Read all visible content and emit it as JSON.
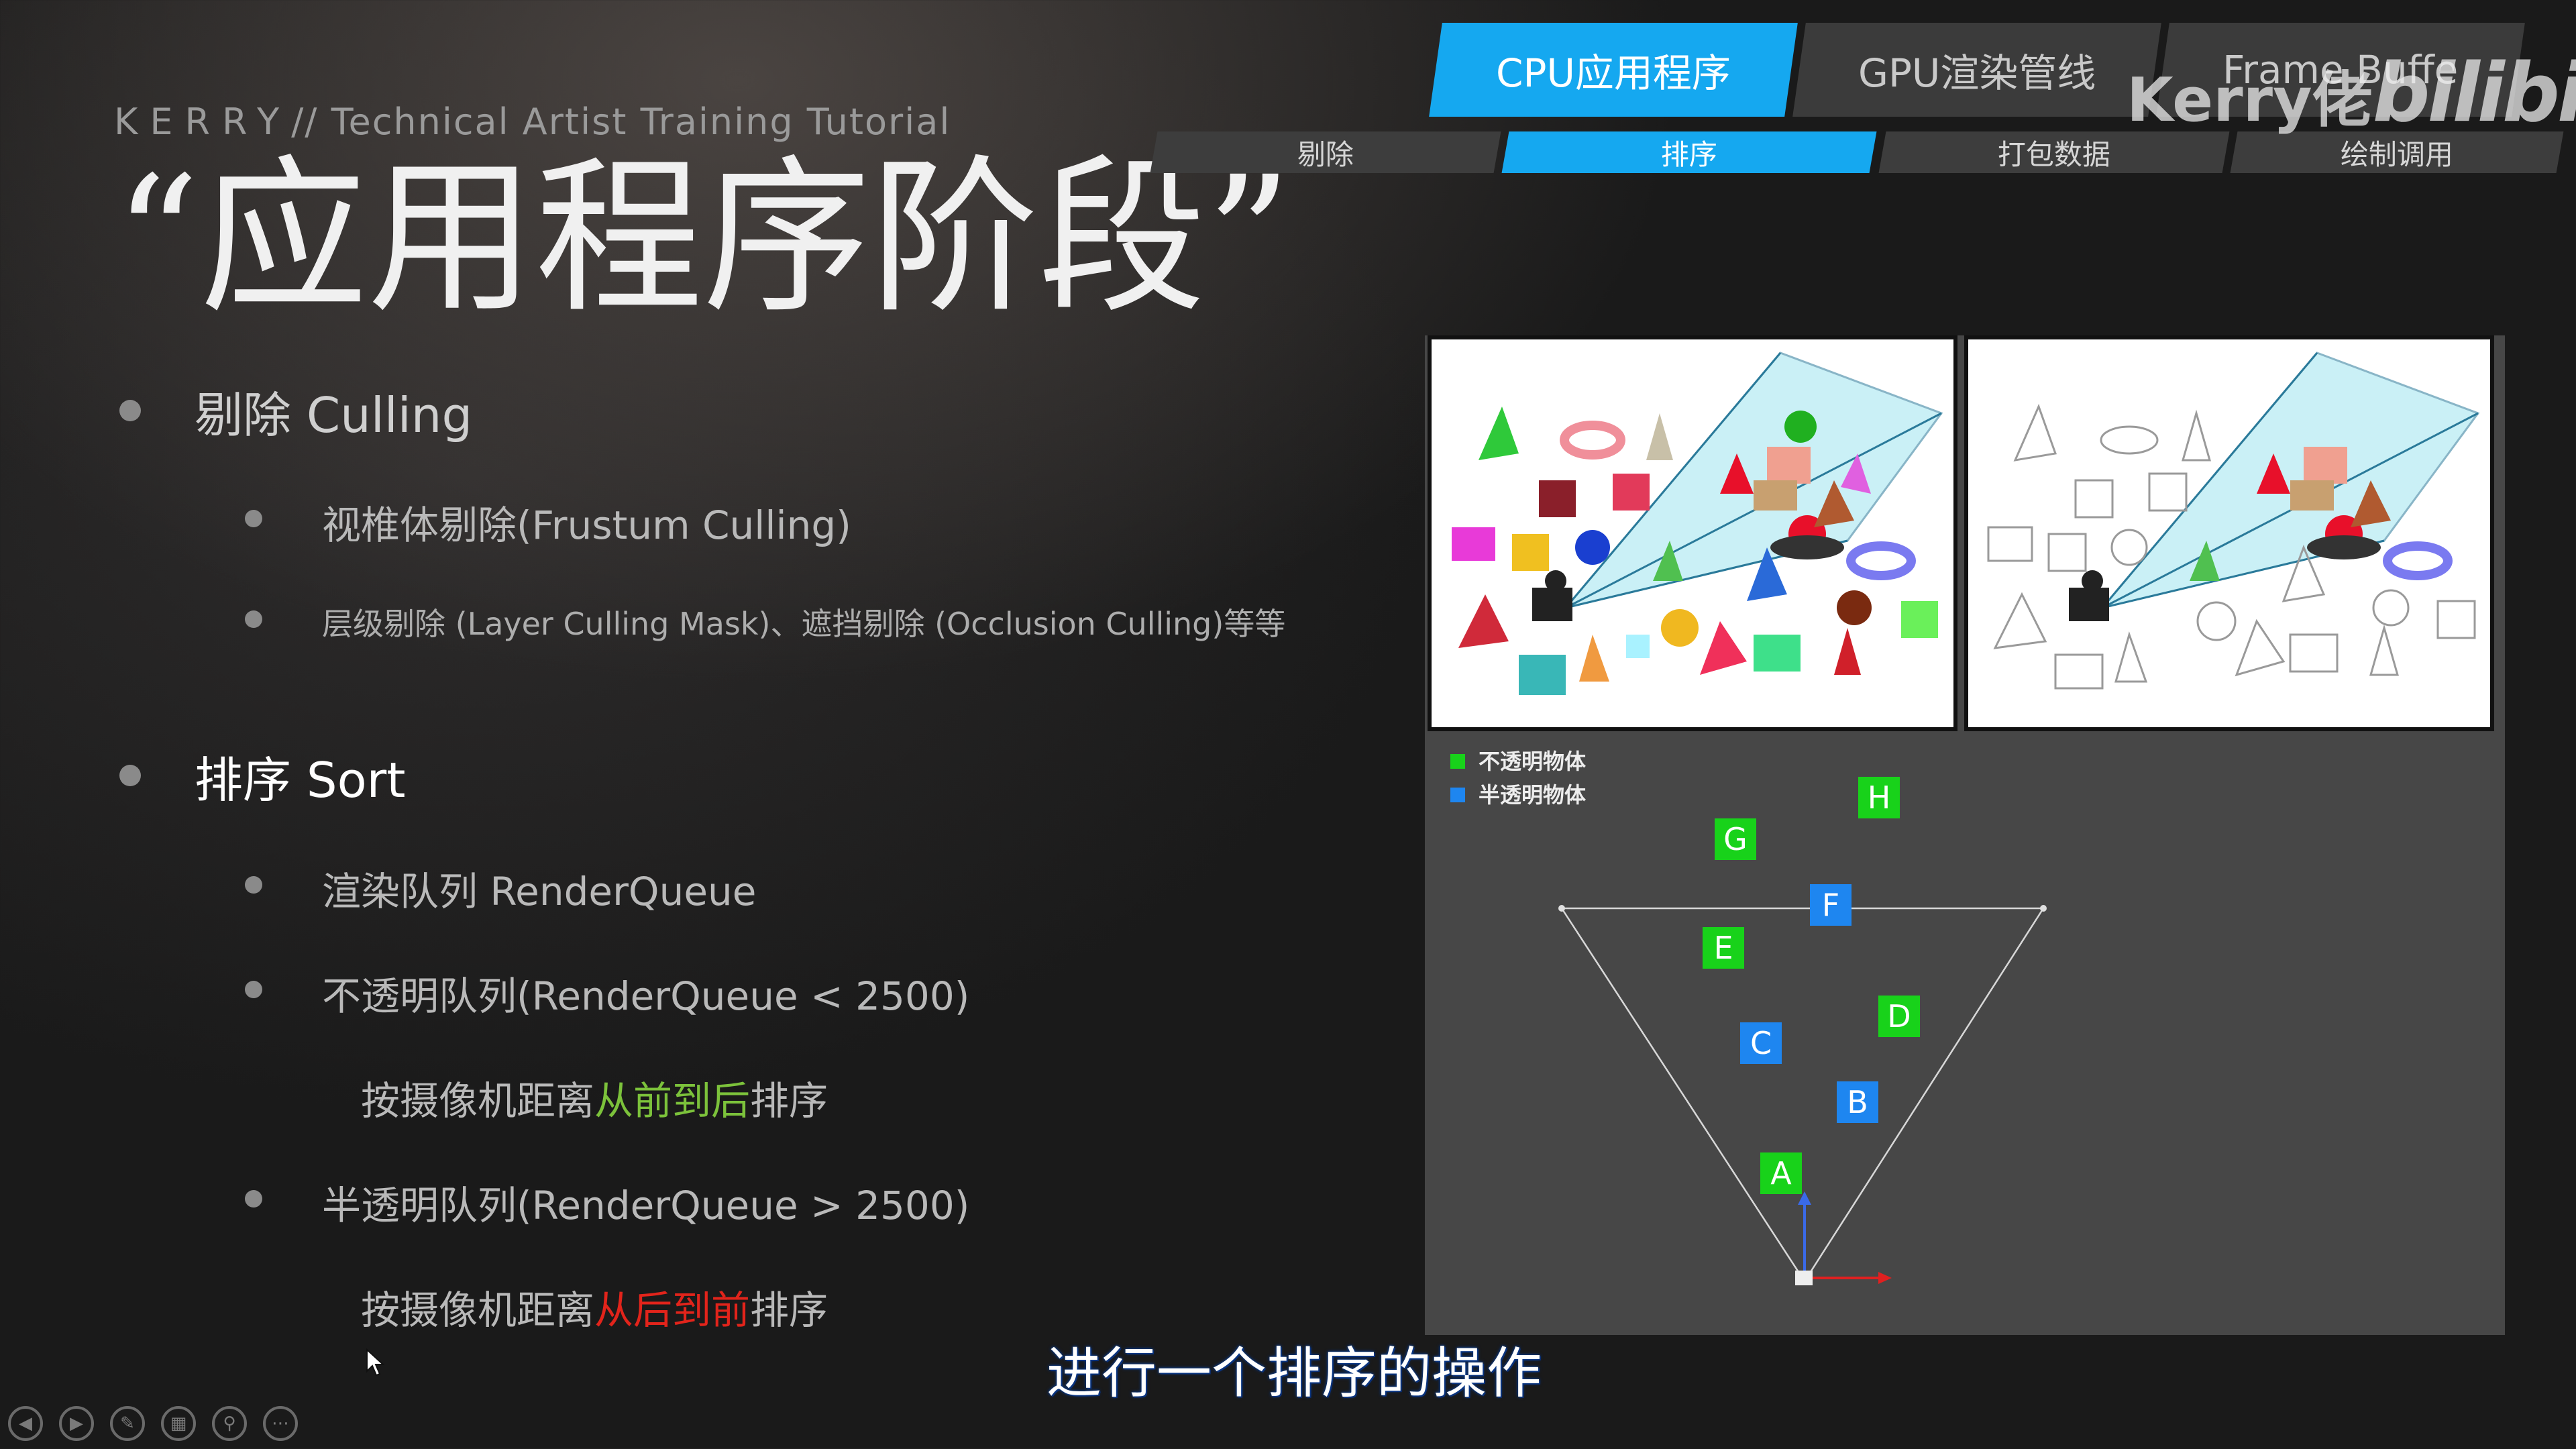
{
  "header": {
    "author": "KERRY",
    "course": "// Technical Artist Training Tutorial",
    "title_open_quote": "“",
    "title": "应用程序阶段",
    "title_close_quote": "”"
  },
  "tabs": [
    {
      "label": "CPU应用程序",
      "active": true
    },
    {
      "label": "GPU渲染管线",
      "active": false
    },
    {
      "label": "Frame Buffe",
      "active": false
    }
  ],
  "subtabs": [
    {
      "label": "剔除",
      "active": false
    },
    {
      "label": "排序",
      "active": true
    },
    {
      "label": "打包数据",
      "active": false
    },
    {
      "label": "绘制调用",
      "active": false
    }
  ],
  "watermark": {
    "name": "Kerry佬",
    "logo": "bilibili"
  },
  "bullets": {
    "culling": "剔除 Culling",
    "frustum": "视椎体剔除(Frustum Culling)",
    "layer": "层级剔除 (Layer Culling Mask)、遮挡剔除 (Occlusion Culling)等等",
    "sort": "排序 Sort",
    "renderqueue": "渲染队列 RenderQueue",
    "opaque": "不透明队列(RenderQueue < 2500)",
    "opaque_note_pre": "按摄像机距离",
    "opaque_note_hl": "从前到后",
    "opaque_note_post": "排序",
    "transparent": "半透明队列(RenderQueue > 2500)",
    "transparent_note_pre": "按摄像机距离",
    "transparent_note_hl": "从后到前",
    "transparent_note_post": "排序"
  },
  "figure": {
    "legend_opaque": "不透明物体",
    "legend_transparent": "半透明物体",
    "labels": {
      "A": "A",
      "B": "B",
      "C": "C",
      "D": "D",
      "E": "E",
      "F": "F",
      "G": "G",
      "H": "H"
    },
    "opaque_color": "#18d21a",
    "transparent_color": "#1e86f0"
  },
  "caption": "进行一个排序的操作",
  "toolbar": [
    "previous-icon",
    "next-icon",
    "pen-icon",
    "slides-icon",
    "zoom-icon",
    "more-icon"
  ]
}
